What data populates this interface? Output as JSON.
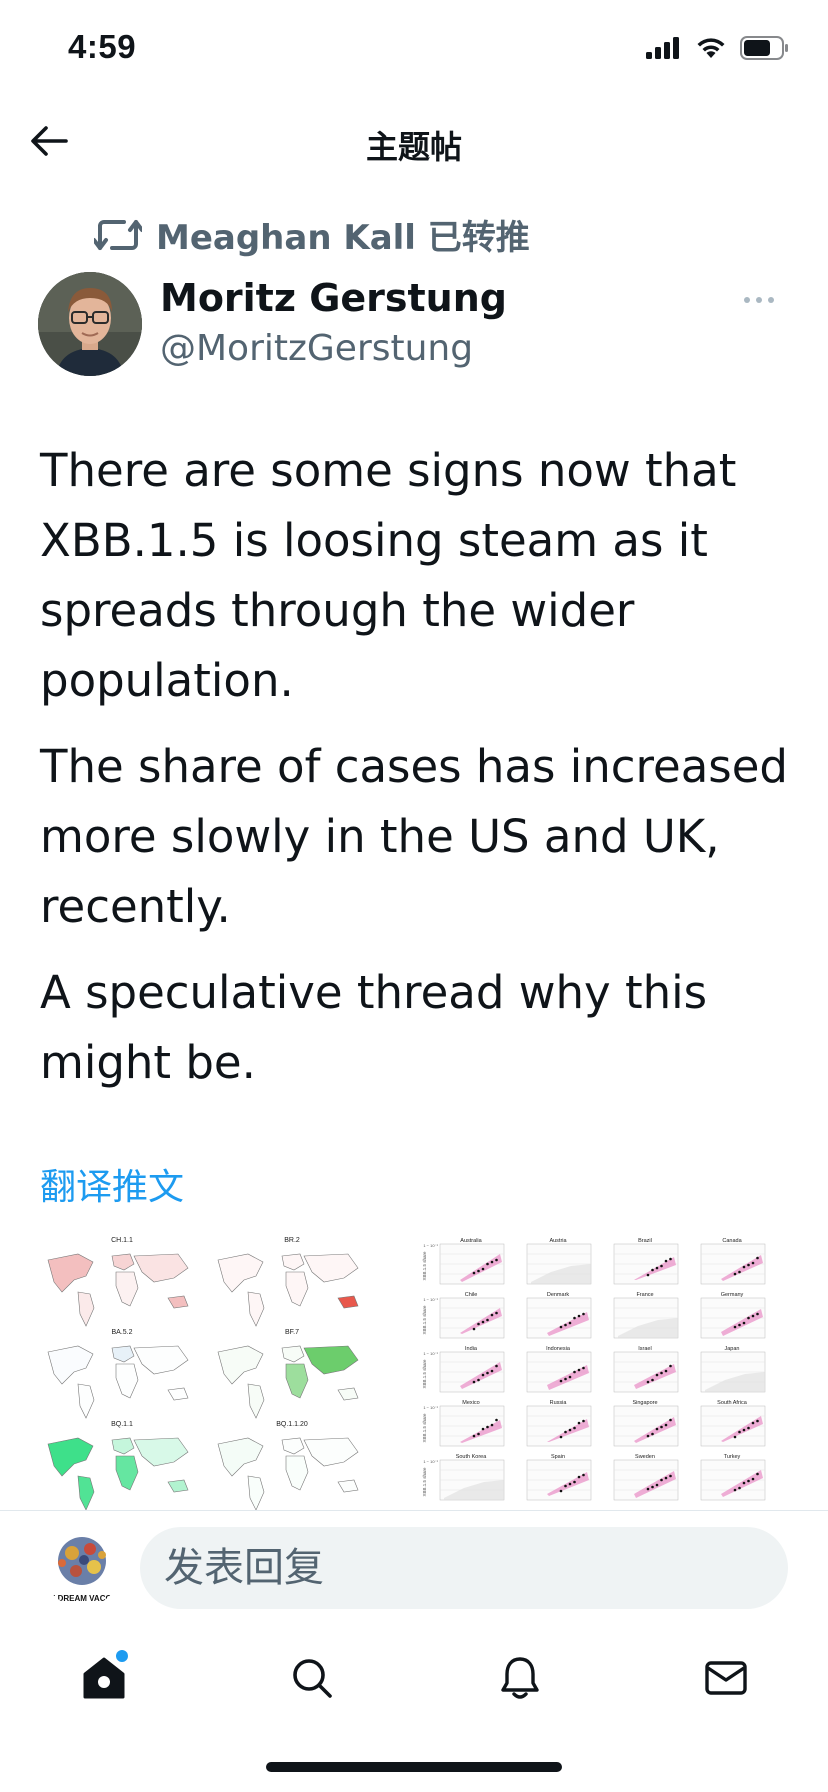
{
  "status": {
    "time": "4:59"
  },
  "nav": {
    "title": "主题帖"
  },
  "retweet": {
    "text": "Meaghan Kall 已转推"
  },
  "author": {
    "name": "Moritz Gerstung",
    "handle": "@MoritzGerstung"
  },
  "tweet": {
    "paragraphs": [
      "There are some signs now that XBB.1.5 is loosing steam as it spreads through the wider population.",
      "The share of cases has increased more slowly in the US and UK, recently.",
      "A speculative thread why this might be."
    ],
    "translate_label": "翻译推文"
  },
  "media": {
    "maps": [
      {
        "label": "CH.1.1",
        "color": "#f2b8b8"
      },
      {
        "label": "BR.2",
        "color": "#e8584c"
      },
      {
        "label": "BA.5.2",
        "color": "#cfe3f2"
      },
      {
        "label": "BF.7",
        "color": "#5cc85c"
      },
      {
        "label": "BQ.1.1",
        "color": "#3ee08a"
      },
      {
        "label": "BQ.1.1.20",
        "color": "#c8f2d8"
      }
    ],
    "panels": {
      "ylabel": "XBB.1.5 share",
      "ytick": "1 − 10⁻¹",
      "countries": [
        "Australia",
        "Austria",
        "Brazil",
        "Canada",
        "Chile",
        "Denmark",
        "France",
        "Germany",
        "India",
        "Indonesia",
        "Israel",
        "Japan",
        "Mexico",
        "Russia",
        "Singapore",
        "South Africa",
        "South Korea",
        "Spain",
        "Sweden",
        "Turkey"
      ]
    }
  },
  "reply": {
    "placeholder": "发表回复",
    "avatar_caption": "THE DREAM VACCINE"
  },
  "colors": {
    "accent": "#1d9bf0",
    "secondary_text": "#536471",
    "text": "#0f1419"
  }
}
